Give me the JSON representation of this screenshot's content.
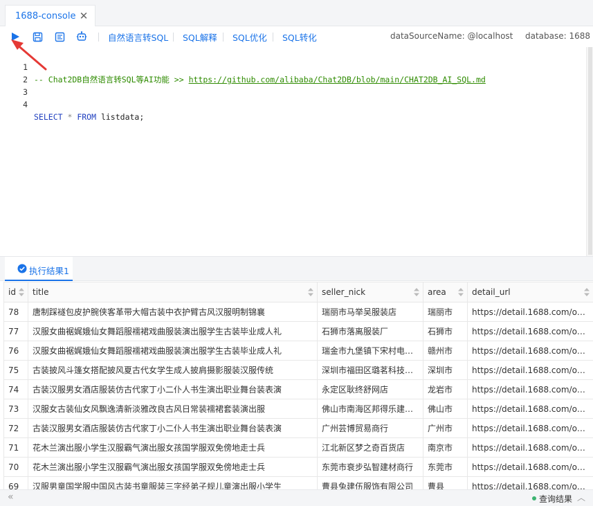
{
  "tab": {
    "title": "1688-console",
    "close_glyph": "✕"
  },
  "toolbar": {
    "icons": [
      "play-icon",
      "save-icon",
      "format-icon",
      "robot-icon"
    ],
    "links": [
      "自然语言转SQL",
      "SQL解释",
      "SQL优化",
      "SQL转化"
    ],
    "data_source": "dataSourceName: @localhost",
    "database": "database: 1688"
  },
  "editor": {
    "lines": [
      {
        "num": "1",
        "comment": "-- Chat2DB自然语言转SQL等AI功能 >> ",
        "link": "https://github.com/alibaba/Chat2DB/blob/main/CHAT2DB_AI_SQL.md"
      },
      {
        "num": "2"
      },
      {
        "num": "3"
      },
      {
        "num": "4",
        "kw1": "SELECT",
        "op": " * ",
        "kw2": "FROM",
        "rest": " listdata;"
      }
    ]
  },
  "result": {
    "tab_label": "执行结果1"
  },
  "table": {
    "columns": [
      "id",
      "title",
      "seller_nick",
      "area",
      "detail_url"
    ],
    "rows": [
      [
        "78",
        "唐制踩襚包皮护腕侠客革带大帽古装中衣护臂古风汉服明制锦襄",
        "瑞丽市马举吴服装店",
        "瑞丽市",
        "https://detail.1688.com/offer/…"
      ],
      [
        "77",
        "汉服女曲裾娓娥仙女舞蹈服襦裙戏曲服装演出服学生古装毕业成人礼",
        "石狮市落离服装厂",
        "石狮市",
        "https://detail.1688.com/offer/…"
      ],
      [
        "76",
        "汉服女曲裾娓娥仙女舞蹈服襦裙戏曲服装演出服学生古装毕业成人礼",
        "瑞金市九堡镇下宋村电商…",
        "赣州市",
        "https://detail.1688.com/offer/…"
      ],
      [
        "75",
        "古装披风斗篷女搭配披风夏古代女学生成人披肩摄影服装汉服传统",
        "深圳市福田区璐茗科技商行",
        "深圳市",
        "https://detail.1688.com/offer/…"
      ],
      [
        "74",
        "古装汉服男女酒店服装仿古代家丁小二仆人书生演出职业舞台装表演",
        "永定区耿终舒网店",
        "龙岩市",
        "https://detail.1688.com/offer/…"
      ],
      [
        "73",
        "汉服女古装仙女风飘逸清新淡雅改良古风日常装襦裙套装演出服",
        "佛山市南海区邦得乐建材…",
        "佛山市",
        "https://detail.1688.com/offer/…"
      ],
      [
        "72",
        "古装汉服男女酒店服装仿古代家丁小二仆人书生演出职业舞台装表演",
        "广州芸博贸易商行",
        "广州市",
        "https://detail.1688.com/offer/…"
      ],
      [
        "71",
        "花木兰演出服小学生汉服霸气演出服女孩国学服双免傍地走士兵",
        "江北新区梦之奇百货店",
        "南京市",
        "https://detail.1688.com/offer/…"
      ],
      [
        "70",
        "花木兰演出服小学生汉服霸气演出服女孩国学服双免傍地走士兵",
        "东莞市衰步弘智建材商行",
        "东莞市",
        "https://detail.1688.com/offer/…"
      ],
      [
        "69",
        "汉服男童国学服中国风古装书童服装三字经弟子规儿童演出服小学生",
        "曹县兔建伍服饰有限公司",
        "曹县",
        "https://detail.1688.com/offer/…"
      ]
    ]
  },
  "statusbar": {
    "left_glyph": "«",
    "query_result": "查询结果",
    "right_glyph": "︿"
  },
  "colors": {
    "accent": "#1a73e8",
    "comment": "#2e8b00",
    "keyword": "#1f3fbf",
    "arrow": "#e53935",
    "status_ok": "#3cb371"
  }
}
